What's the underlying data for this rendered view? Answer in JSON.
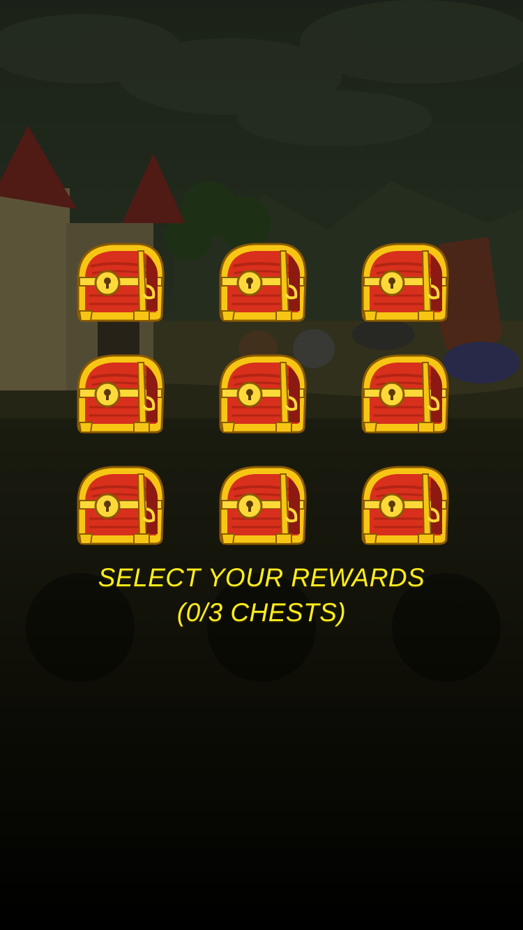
{
  "reward_screen": {
    "title": "SELECT YOUR REWARDS",
    "counter": "(0/3 CHESTS)",
    "selected_count": 0,
    "max_selection": 3
  },
  "chests": [
    {
      "id": "chest-1",
      "state": "closed"
    },
    {
      "id": "chest-2",
      "state": "closed"
    },
    {
      "id": "chest-3",
      "state": "closed"
    },
    {
      "id": "chest-4",
      "state": "closed"
    },
    {
      "id": "chest-5",
      "state": "closed"
    },
    {
      "id": "chest-6",
      "state": "closed"
    },
    {
      "id": "chest-7",
      "state": "closed"
    },
    {
      "id": "chest-8",
      "state": "closed"
    },
    {
      "id": "chest-9",
      "state": "closed"
    }
  ],
  "colors": {
    "text_accent": "#ffee1c",
    "chest_red": "#d8301c",
    "chest_gold": "#f7c615"
  }
}
